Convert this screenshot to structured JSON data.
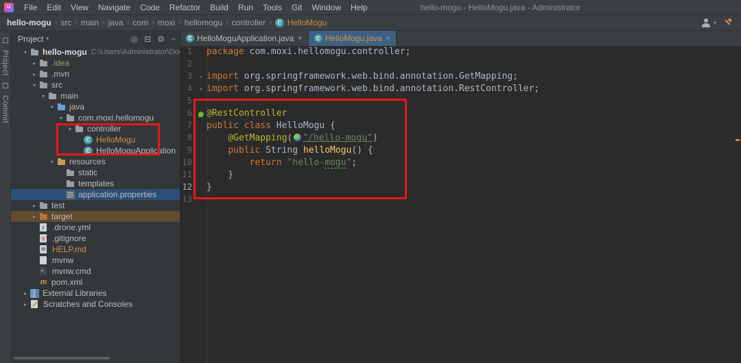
{
  "title_bar": {
    "menus": [
      "File",
      "Edit",
      "View",
      "Navigate",
      "Code",
      "Refactor",
      "Build",
      "Run",
      "Tools",
      "Git",
      "Window",
      "Help"
    ],
    "title": "hello-mogu - HelloMogu.java - Administrator"
  },
  "toolbar": {
    "breadcrumbs": [
      "hello-mogu",
      "src",
      "main",
      "java",
      "com",
      "moxi",
      "hellomogu",
      "controller"
    ],
    "breadcrumb_file": "HelloMogu"
  },
  "left_stripe": {
    "project_label": "Project",
    "commit_label": "Commit"
  },
  "project_panel": {
    "header_label": "Project",
    "header_icons": [
      {
        "name": "locate-icon",
        "glyph": "◎"
      },
      {
        "name": "collapse-all-icon",
        "glyph": "⊟"
      },
      {
        "name": "settings-gear-icon",
        "glyph": "⚙"
      },
      {
        "name": "hide-panel-icon",
        "glyph": "−"
      }
    ],
    "tree": [
      {
        "label": "hello-mogu",
        "hint": "C:\\Users\\Administrator\\Downlo",
        "level": 0,
        "icon": "folder",
        "chevron": "expanded",
        "bold": true
      },
      {
        "label": ".idea",
        "level": 1,
        "icon": "folder",
        "chevron": "collapsed",
        "color_class": "ignored"
      },
      {
        "label": ".mvn",
        "level": 1,
        "icon": "folder",
        "chevron": "collapsed"
      },
      {
        "label": "src",
        "level": 1,
        "icon": "folder",
        "chevron": "expanded"
      },
      {
        "label": "main",
        "level": 2,
        "icon": "folder",
        "chevron": "expanded"
      },
      {
        "label": "java",
        "level": 3,
        "icon": "source-folder",
        "chevron": "expanded"
      },
      {
        "label": "com.moxi.hellomogu",
        "level": 4,
        "icon": "folder",
        "chevron": "expanded"
      },
      {
        "label": "controller",
        "level": 5,
        "icon": "folder",
        "chevron": "expanded"
      },
      {
        "label": "HelloMogu",
        "level": 6,
        "icon": "class",
        "color_class": "orange"
      },
      {
        "label": "HelloMoguApplication",
        "level": 6,
        "icon": "class"
      },
      {
        "label": "resources",
        "level": 3,
        "icon": "resource-folder",
        "chevron": "expanded"
      },
      {
        "label": "static",
        "level": 4,
        "icon": "folder"
      },
      {
        "label": "templates",
        "level": 4,
        "icon": "folder"
      },
      {
        "label": "application.properties",
        "level": 4,
        "icon": "properties",
        "row_class": "selected"
      },
      {
        "label": "test",
        "level": 1,
        "icon": "folder",
        "chevron": "collapsed"
      },
      {
        "label": "target",
        "level": 1,
        "icon": "folder-excluded",
        "chevron": "collapsed",
        "row_class": "excluded-row"
      },
      {
        "label": ".drone.yml",
        "level": 1,
        "icon": "yml"
      },
      {
        "label": ".gitignore",
        "level": 1,
        "icon": "git"
      },
      {
        "label": "HELP.md",
        "level": 1,
        "icon": "markdown",
        "color_class": "orange"
      },
      {
        "label": "mvnw",
        "level": 1,
        "icon": "file"
      },
      {
        "label": "mvnw.cmd",
        "level": 1,
        "icon": "cmd"
      },
      {
        "label": "pom.xml",
        "level": 1,
        "icon": "maven"
      },
      {
        "label": "External Libraries",
        "level": 0,
        "icon": "libraries",
        "chevron": "collapsed"
      },
      {
        "label": "Scratches and Consoles",
        "level": 0,
        "icon": "scratches",
        "chevron": "collapsed"
      }
    ]
  },
  "editor": {
    "tabs": [
      {
        "label": "HelloMoguApplication.java",
        "active": false
      },
      {
        "label": "HelloMogu.java",
        "active": true
      }
    ],
    "stripe_mark_color": "#cf8a3f",
    "lines": [
      {
        "n": 1,
        "tokens": [
          {
            "t": "package ",
            "c": "kw"
          },
          {
            "t": "com.moxi.hellomogu.controller;",
            "c": "plain"
          }
        ]
      },
      {
        "n": 2,
        "tokens": []
      },
      {
        "n": 3,
        "fold": true,
        "tokens": [
          {
            "t": "import ",
            "c": "kw"
          },
          {
            "t": "org.springframework.web.bind.annotation.GetMapping;",
            "c": "plain"
          }
        ]
      },
      {
        "n": 4,
        "fold": true,
        "tokens": [
          {
            "t": "import ",
            "c": "kw"
          },
          {
            "t": "org.springframework.web.bind.annotation.RestController;",
            "c": "plain"
          }
        ]
      },
      {
        "n": 5,
        "tokens": []
      },
      {
        "n": 6,
        "gutter_icon": "spring-bean",
        "tokens": [
          {
            "t": "@RestController",
            "c": "ann"
          }
        ]
      },
      {
        "n": 7,
        "tokens": [
          {
            "t": "public class ",
            "c": "kw"
          },
          {
            "t": "HelloMogu ",
            "c": "cls"
          },
          {
            "t": "{",
            "c": "plain"
          }
        ]
      },
      {
        "n": 8,
        "tokens": [
          {
            "t": "    ",
            "c": "plain"
          },
          {
            "t": "@GetMapping",
            "c": "ann"
          },
          {
            "t": "(",
            "c": "plain"
          },
          {
            "t": "",
            "c": "inlay"
          },
          {
            "t": "\"/hello-mogu\"",
            "c": "strlink"
          },
          {
            "t": ")",
            "c": "plain"
          }
        ]
      },
      {
        "n": 9,
        "tokens": [
          {
            "t": "    ",
            "c": "plain"
          },
          {
            "t": "public ",
            "c": "kw"
          },
          {
            "t": "String ",
            "c": "plain"
          },
          {
            "t": "helloMogu",
            "c": "method"
          },
          {
            "t": "() {",
            "c": "plain"
          }
        ]
      },
      {
        "n": 10,
        "tokens": [
          {
            "t": "        ",
            "c": "plain"
          },
          {
            "t": "return ",
            "c": "kw"
          },
          {
            "t": "\"hello-",
            "c": "str"
          },
          {
            "t": "mogu",
            "c": "str typo"
          },
          {
            "t": "\"",
            "c": "str"
          },
          {
            "t": ";",
            "c": "plain"
          }
        ]
      },
      {
        "n": 11,
        "tokens": [
          {
            "t": "    }",
            "c": "plain"
          }
        ]
      },
      {
        "n": 12,
        "current": true,
        "tokens": [
          {
            "t": "}",
            "c": "plain"
          }
        ]
      },
      {
        "n": 13,
        "tokens": []
      }
    ]
  }
}
